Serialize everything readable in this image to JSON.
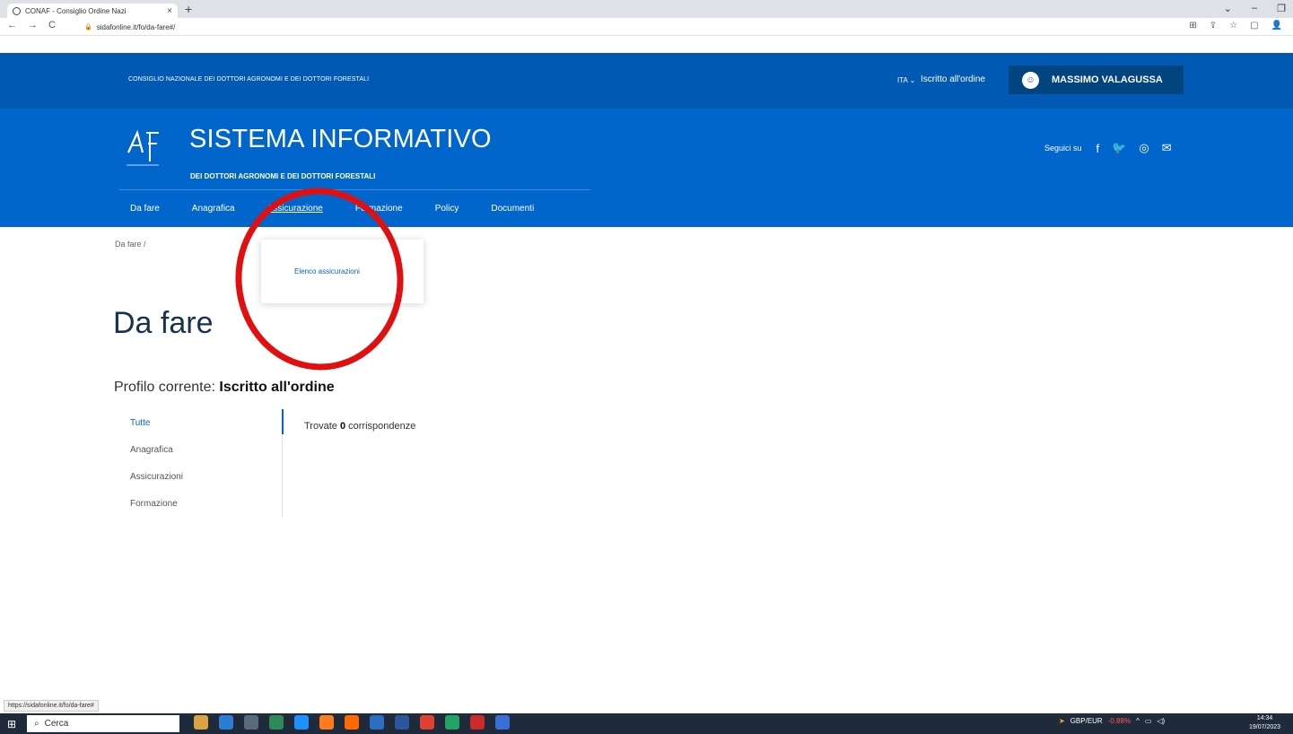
{
  "browser": {
    "tab_title": "CONAF - Consiglio Ordine Nazi",
    "tab_close": "×",
    "new_tab": "+",
    "url": "sidafonline.it/fo/da-fare#/",
    "nav": {
      "back": "←",
      "forward": "→",
      "reload": "C"
    },
    "window_controls": {
      "dropdown": "⌄",
      "minimize": "–",
      "restore": "❐"
    },
    "extensions": [
      "⊞",
      "⇪",
      "☆",
      "▢",
      "👤"
    ]
  },
  "topbar": {
    "org_name": "CONSIGLIO NAZIONALE DEI DOTTORI AGRONOMI E DEI DOTTORI FORESTALI",
    "language": "ITA ⌄",
    "role_link": "Iscritto all'ordine",
    "user_name": "MASSIMO VALAGUSSA"
  },
  "header": {
    "logo_mark": "A F",
    "title": "SISTEMA INFORMATIVO",
    "subtitle": "DEI DOTTORI AGRONOMI E DEI DOTTORI FORESTALI",
    "follow_label": "Seguici su",
    "socials": [
      "f",
      "🐦",
      "◎",
      "✉"
    ]
  },
  "main_nav": {
    "items": [
      {
        "label": "Da fare"
      },
      {
        "label": "Anagrafica"
      },
      {
        "label": "Assicurazione"
      },
      {
        "label": "Formazione"
      },
      {
        "label": "Policy"
      },
      {
        "label": "Documenti"
      }
    ],
    "active_index": 2
  },
  "dropdown": {
    "item": "Elenco assicurazioni"
  },
  "content": {
    "breadcrumb": "Da fare  /",
    "page_title": "Da fare",
    "profile_prefix": "Profilo corrente: ",
    "profile_value": "Iscritto all'ordine",
    "filters": [
      "Tutte",
      "Anagrafica",
      "Assicurazioni",
      "Formazione"
    ],
    "active_filter": "Tutte",
    "results_prefix": "Trovate ",
    "results_count": "0",
    "results_suffix": " corrispondenze"
  },
  "status_hint": "https://sidafonline.it/fo/da-fare#",
  "taskbar": {
    "search_placeholder": "Cerca",
    "fx_pair": "GBP/EUR",
    "fx_change": "-0.88%",
    "time": "14:34",
    "date": "19/07/2023",
    "app_colors": [
      "#d9a441",
      "#2b7cd3",
      "#5a6b80",
      "#2e8b57",
      "#1e90ff",
      "#ff7b1c",
      "#ff6a00",
      "#2b6fc2",
      "#2b579a",
      "#e0402f",
      "#21a366",
      "#cc2a2a",
      "#3a6fd8"
    ]
  },
  "colors": {
    "topbar_blue": "#0059b3",
    "header_blue": "#0066cc",
    "user_button_blue": "#004480",
    "annotation_red": "#e01010"
  }
}
